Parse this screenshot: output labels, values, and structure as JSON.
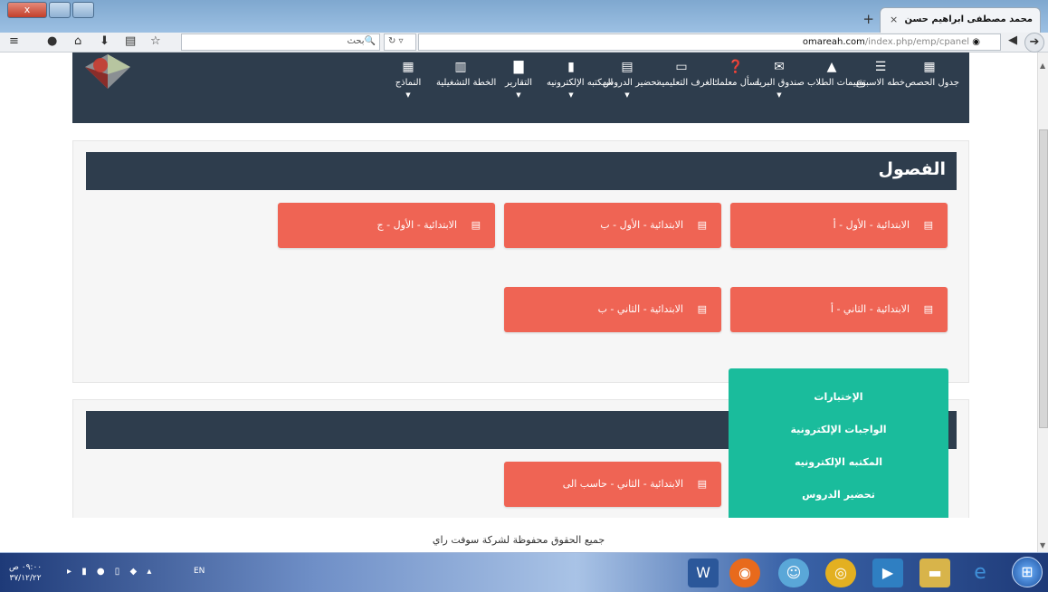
{
  "window": {
    "close": "x",
    "tab_title": "محمد مصطفى ابراهيم حسن",
    "tab_close": "×",
    "newtab": "+"
  },
  "toolbar": {
    "search_placeholder": "بحث",
    "search_icon": "🔍",
    "url_domain": "omareah.com",
    "url_path": "/index.php/emp/cpanel"
  },
  "topnav": {
    "items": [
      {
        "label": "جدول الحصص",
        "icon": "grid-icon",
        "glyph": "▦",
        "caret": false
      },
      {
        "label": "خطه الاسبوع",
        "icon": "list-icon",
        "glyph": "☰",
        "caret": false
      },
      {
        "label": "تقييمات الطلاب",
        "icon": "chart-icon",
        "glyph": "▲",
        "caret": false
      },
      {
        "label": "صندوق البريد",
        "icon": "mail-icon",
        "glyph": "✉",
        "caret": true
      },
      {
        "label": "اسأل معلمك",
        "icon": "question-icon",
        "glyph": "❓",
        "caret": false
      },
      {
        "label": "الغرف التعليميه",
        "icon": "monitor-icon",
        "glyph": "▭",
        "caret": false
      },
      {
        "label": "تحضير الدروس",
        "icon": "list-alt-icon",
        "glyph": "▤",
        "caret": true
      },
      {
        "label": "المكتبه الإلكترونيه",
        "icon": "book-icon",
        "glyph": "▮",
        "caret": true
      },
      {
        "label": "التقارير",
        "icon": "file-icon",
        "glyph": "▇",
        "caret": true
      },
      {
        "label": "الخطة التشغيلية",
        "icon": "bar-chart-icon",
        "glyph": "▥",
        "caret": false
      },
      {
        "label": "النماذج",
        "icon": "grid-large-icon",
        "glyph": "▦",
        "caret": true
      }
    ]
  },
  "panel1": {
    "title": "الفصول",
    "classes": [
      {
        "label": "الابتدائية - الأول - أ"
      },
      {
        "label": "الابتدائية - الأول - ب"
      },
      {
        "label": "الابتدائية - الأول - ج"
      },
      {
        "label": "الابتدائية - الثاني - أ"
      },
      {
        "label": "الابتدائية - الثاني - ب"
      }
    ]
  },
  "panel2": {
    "title": "",
    "classes": [
      {
        "label": "الابتدائية - الثاني - حاسب الى"
      }
    ]
  },
  "popup": {
    "items": [
      "الإختبارات",
      "الواجبات الإلكترونية",
      "المكتبه الإلكترونيه",
      "تحضير الدروس"
    ]
  },
  "footer": {
    "text": "جميع الحقوق محفوظة لشركة سوفت راي"
  },
  "taskbar": {
    "clock_time": "٠٩:٠٠ ص",
    "clock_date": "٣٧/١٢/٢٢",
    "lang": "EN"
  }
}
